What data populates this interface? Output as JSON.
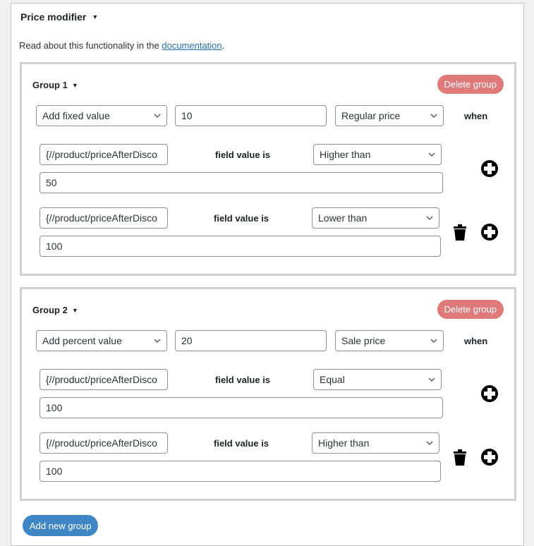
{
  "panel": {
    "title": "Price modifier",
    "doc_prefix": "Read about this functionality in the ",
    "doc_link": "documentation",
    "doc_suffix": "."
  },
  "colors": {
    "delete": "#e07a7a",
    "primary": "#3f86c7",
    "link": "#2271b1"
  },
  "groups": [
    {
      "title": "Group 1",
      "delete_label": "Delete group",
      "modifier_type": "Add fixed value",
      "amount": "10",
      "price_type": "Regular price",
      "when_label": "when",
      "conditions": [
        {
          "field": "{//product/priceAfterDisco",
          "label": "field value is",
          "operator": "Higher than",
          "value": "50"
        },
        {
          "field": "{//product/priceAfterDisco",
          "label": "field value is",
          "operator": "Lower than",
          "value": "100"
        }
      ]
    },
    {
      "title": "Group 2",
      "delete_label": "Delete group",
      "modifier_type": "Add percent value",
      "amount": "20",
      "price_type": "Sale price",
      "when_label": "when",
      "conditions": [
        {
          "field": "{//product/priceAfterDisco",
          "label": "field value is",
          "operator": "Equal",
          "value": "100"
        },
        {
          "field": "{//product/priceAfterDisco",
          "label": "field value is",
          "operator": "Higher than",
          "value": "100"
        }
      ]
    }
  ],
  "add_group_label": "Add new group",
  "icons": {
    "caret": "▼",
    "delete_condition": "trash-icon",
    "add_condition": "plus-circle-icon"
  }
}
